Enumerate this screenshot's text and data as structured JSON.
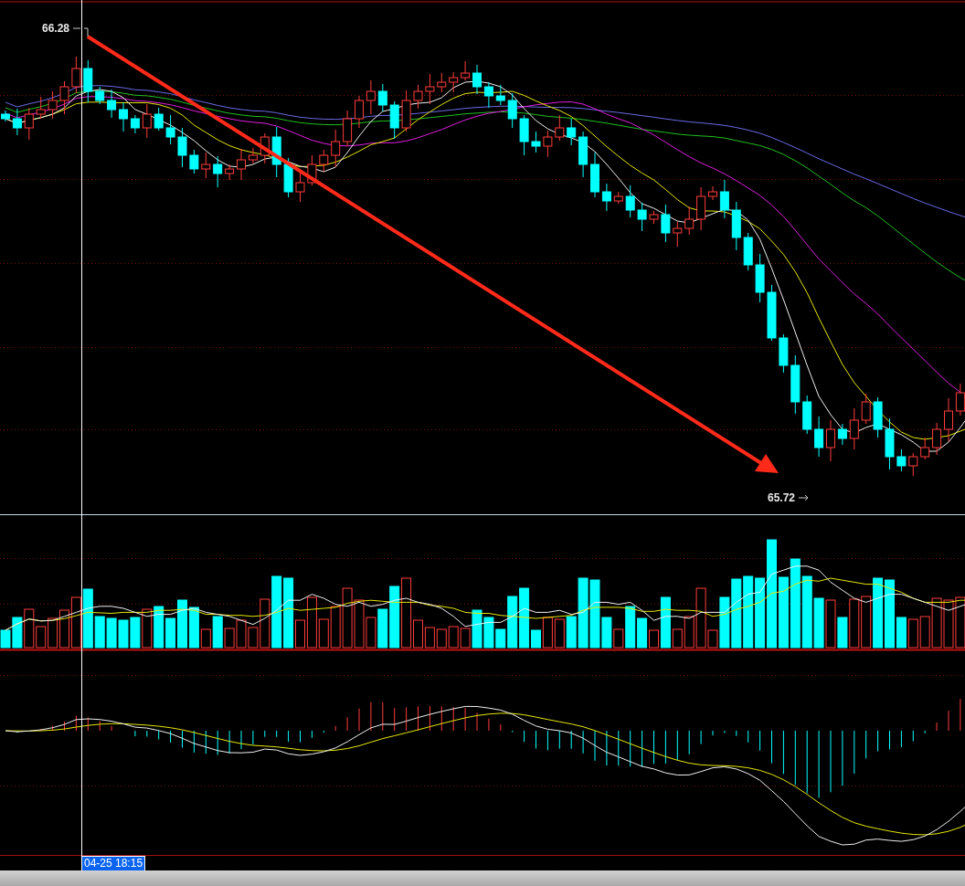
{
  "price_labels": {
    "high": "66.28",
    "low": "65.72"
  },
  "crosshair": {
    "time": "04-25 18:15"
  }
}
